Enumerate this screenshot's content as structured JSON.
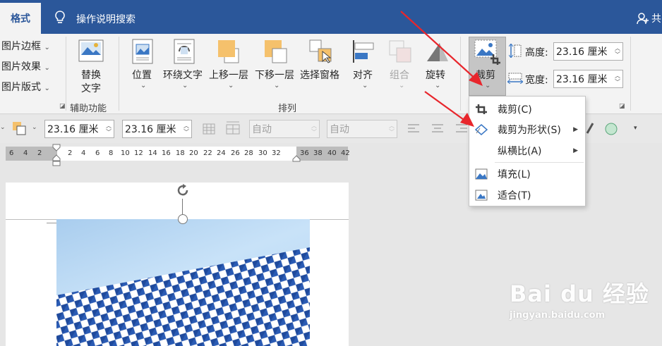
{
  "tabs": {
    "active": "格式"
  },
  "search": {
    "label": "操作说明搜索"
  },
  "share": {
    "label": "共"
  },
  "ribbon": {
    "picture_border": "图片边框",
    "picture_effects": "图片效果",
    "picture_layout": "图片版式",
    "alt_text_line1": "替换",
    "alt_text_line2": "文字",
    "accessibility_group": "辅助功能",
    "position": "位置",
    "wrap_text": "环绕文字",
    "bring_forward": "上移一层",
    "send_backward": "下移一层",
    "selection_pane": "选择窗格",
    "align": "对齐",
    "group": "组合",
    "rotate": "旋转",
    "arrange_group": "排列",
    "crop": "裁剪",
    "height_label": "高度:",
    "width_label": "宽度:",
    "height_value": "23.16 厘米",
    "width_value": "23.16 厘米"
  },
  "toolbar2": {
    "width_value": "23.16 厘米",
    "height_value": "23.16 厘米",
    "auto1": "自动",
    "auto2": "自动"
  },
  "ruler": {
    "left_numbers": [
      "6",
      "4",
      "2"
    ],
    "numbers": [
      "2",
      "4",
      "6",
      "8",
      "10",
      "12",
      "14",
      "16",
      "18",
      "20",
      "22",
      "24",
      "26",
      "28",
      "30",
      "32"
    ],
    "right_numbers": [
      "36",
      "38",
      "40",
      "42"
    ]
  },
  "crop_menu": {
    "items": [
      {
        "label": "裁剪(C)",
        "icon": "crop-icon",
        "submenu": false
      },
      {
        "label": "裁剪为形状(S)",
        "icon": "shape-icon",
        "submenu": true
      },
      {
        "label": "纵横比(A)",
        "icon": "",
        "submenu": true
      },
      {
        "label": "填充(L)",
        "icon": "fill-icon",
        "submenu": false
      },
      {
        "label": "适合(T)",
        "icon": "fit-icon",
        "submenu": false
      }
    ]
  },
  "watermark": {
    "brand": "Bai du 经验",
    "url": "jingyan.baidu.com"
  },
  "colors": {
    "title_blue": "#2b579a",
    "accent_red": "#e8262c",
    "highlight": "#c5c5c5"
  }
}
